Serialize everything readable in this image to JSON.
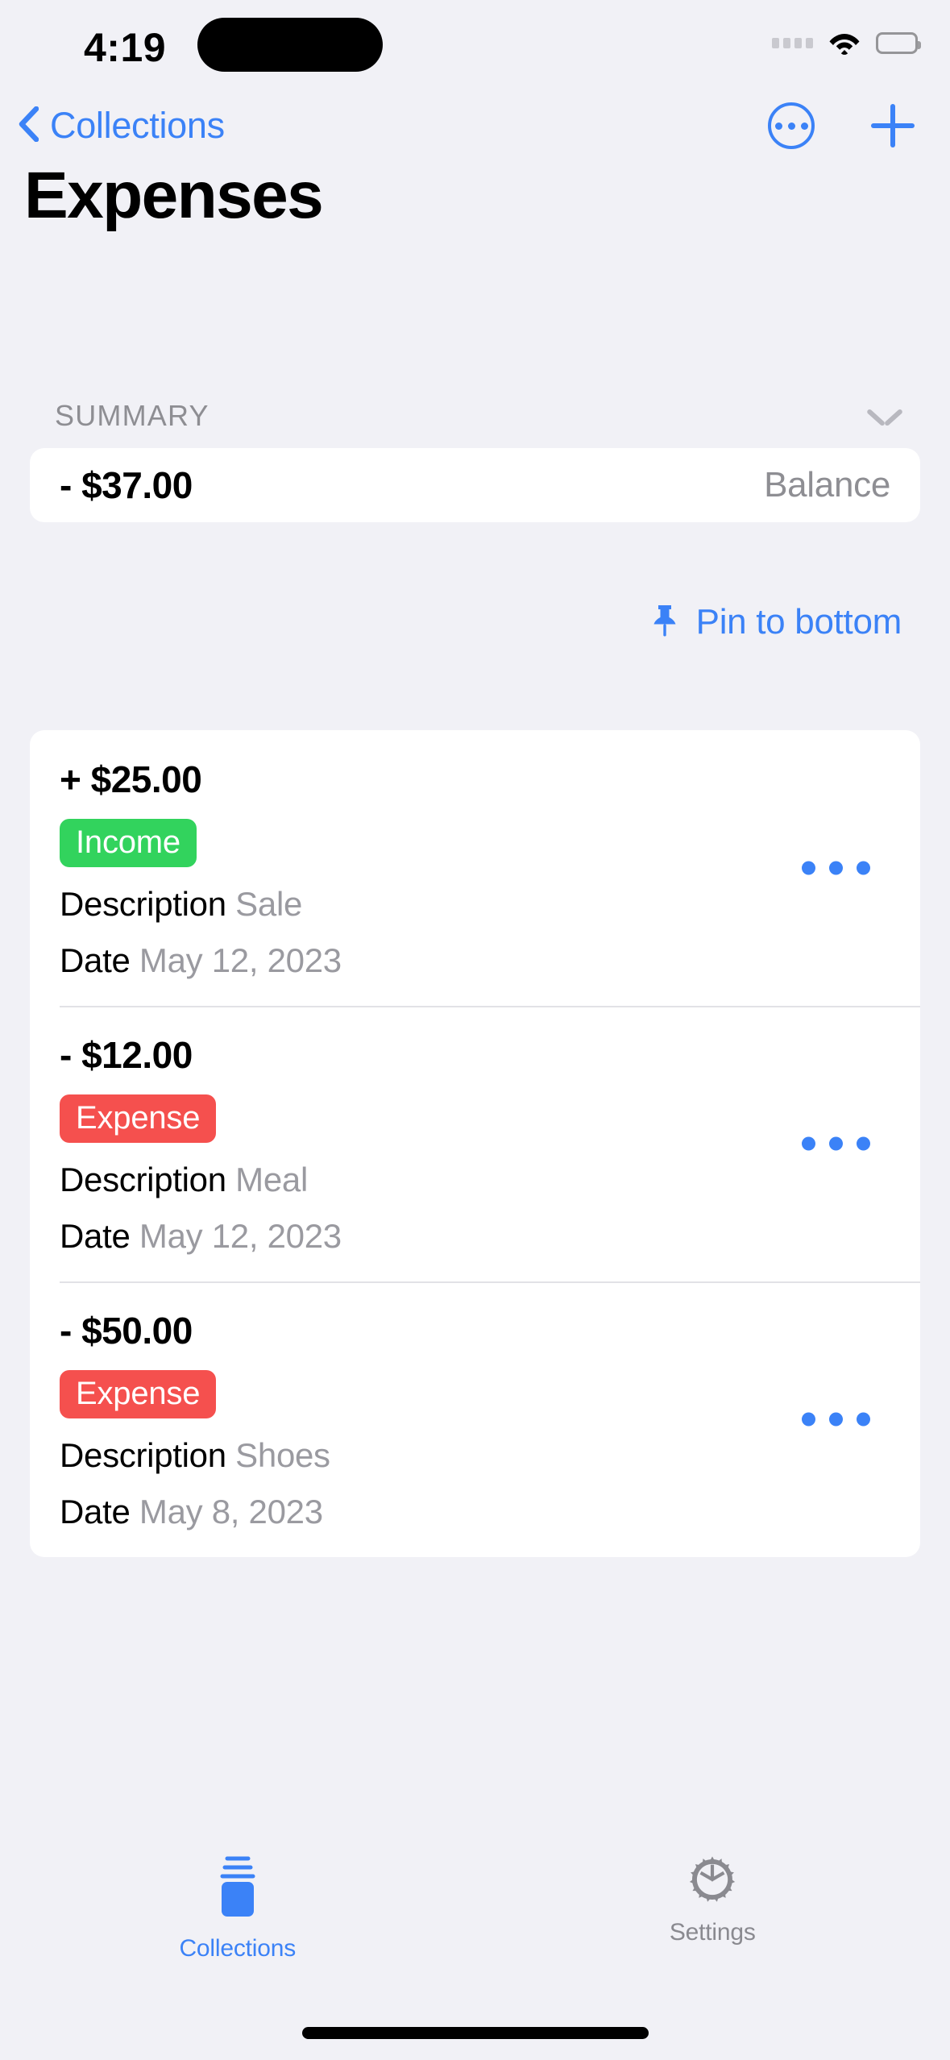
{
  "status_bar": {
    "time": "4:19",
    "cellular_icon": "cellular-dots-icon",
    "wifi_icon": "wifi-icon",
    "battery_icon": "battery-icon"
  },
  "nav": {
    "back_label": "Collections",
    "back_icon": "chevron-left-icon",
    "more_icon": "circle-ellipsis-icon",
    "add_icon": "plus-icon",
    "accent_color": "#3b82f7"
  },
  "header": {
    "title": "Expenses"
  },
  "summary": {
    "section_label": "SUMMARY",
    "collapse_icon": "chevron-down-icon",
    "balance_amount": "- $37.00",
    "balance_label": "Balance"
  },
  "pin": {
    "icon": "pushpin-icon",
    "label": "Pin to bottom"
  },
  "transactions": {
    "field_labels": {
      "description": "Description",
      "date": "Date"
    },
    "row_menu_icon": "ellipsis-icon",
    "items": [
      {
        "amount": "+ $25.00",
        "type": "Income",
        "type_color": "#32d35d",
        "description_label": "Description",
        "description": "Sale",
        "date_label": "Date",
        "date": "May 12, 2023"
      },
      {
        "amount": "- $12.00",
        "type": "Expense",
        "type_color": "#f5504e",
        "description_label": "Description",
        "description": "Meal",
        "date_label": "Date",
        "date": "May 12, 2023"
      },
      {
        "amount": "- $50.00",
        "type": "Expense",
        "type_color": "#f5504e",
        "description_label": "Description",
        "description": "Shoes",
        "date_label": "Date",
        "date": "May 8, 2023"
      }
    ]
  },
  "tabbar": {
    "tabs": [
      {
        "label": "Collections",
        "icon": "archivebox-icon",
        "active": true
      },
      {
        "label": "Settings",
        "icon": "gear-icon",
        "active": false
      }
    ]
  }
}
